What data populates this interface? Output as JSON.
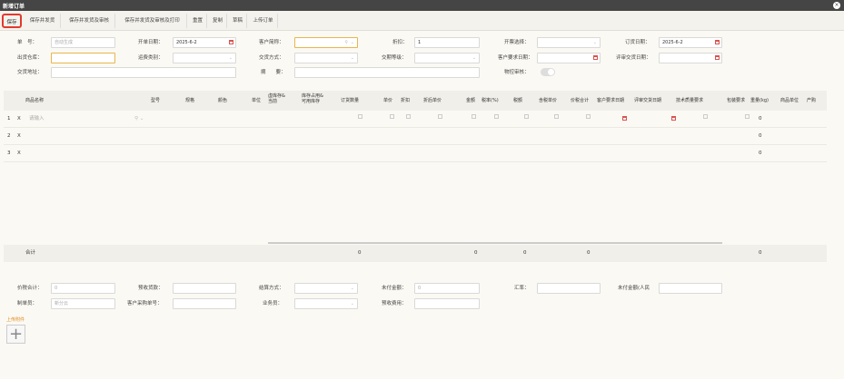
{
  "window": {
    "title": "新增订单",
    "close": "×"
  },
  "toolbar": {
    "buttons": [
      "保存",
      "保存并发货",
      "保存并发货及审核",
      "保存并发货及审核及打印",
      "重置",
      "复制",
      "草稿",
      "上传订单"
    ]
  },
  "form": {
    "order_no_label": "单　号：",
    "order_no_placeholder": "自动生成",
    "open_date_label": "开单日期：",
    "open_date_value": "2025-6-2",
    "customer_label": "客户简称：",
    "discount_label": "折扣：",
    "discount_value": "1",
    "invoice_label": "开票选择：",
    "order_date_label": "订货日期：",
    "order_date_value": "2025-6-2",
    "warehouse_label": "出货仓库：",
    "shipping_type_label": "运费类别：",
    "trade_method_label": "交货方式：",
    "delivery_level_label": "交期等级：",
    "cust_req_date_label": "客户要求日期：",
    "review_date_label": "评审交货日期：",
    "delivery_addr_label": "交货地址：",
    "summary_label": "摘　　要：",
    "logistics_label": "物控审核："
  },
  "grid": {
    "headers": [
      "商品名称",
      "型号",
      "规格",
      "颜色",
      "单位",
      "虚库存&\n当前",
      "库存占用&\n可用库存",
      "订货数量",
      "单价",
      "折扣",
      "折后单价",
      "金额",
      "税率(%)",
      "税额",
      "含税单价",
      "价税合计",
      "客户要求日期",
      "评审交货日期",
      "技术质量要求",
      "包装要求",
      "重量(kg)",
      "商品单位",
      "产购"
    ],
    "rows": [
      {
        "num": "1",
        "del": "X",
        "name_placeholder": "请输入",
        "weight": "0"
      },
      {
        "num": "2",
        "del": "X",
        "weight": "0"
      },
      {
        "num": "3",
        "del": "X",
        "weight": "0"
      }
    ],
    "total": {
      "label": "合计",
      "qty": "0",
      "amount": "0",
      "tax": "0",
      "total": "0",
      "weight": "0"
    }
  },
  "footer": {
    "tax_total_label": "价税合计：",
    "tax_total_value": "0",
    "prepay_label": "预收货款：",
    "settle_label": "结算方式：",
    "unpaid_label": "未付金额：",
    "unpaid_value": "0",
    "rate_label": "汇率：",
    "unpaid_rmb_label": "未付金额(人民",
    "maker_label": "制单员：",
    "maker_value": "新分云",
    "cust_po_label": "客户采购单号：",
    "sales_label": "业务员：",
    "prefee_label": "预收费用："
  },
  "attachments": {
    "label": "上传附件",
    "add": "+"
  }
}
